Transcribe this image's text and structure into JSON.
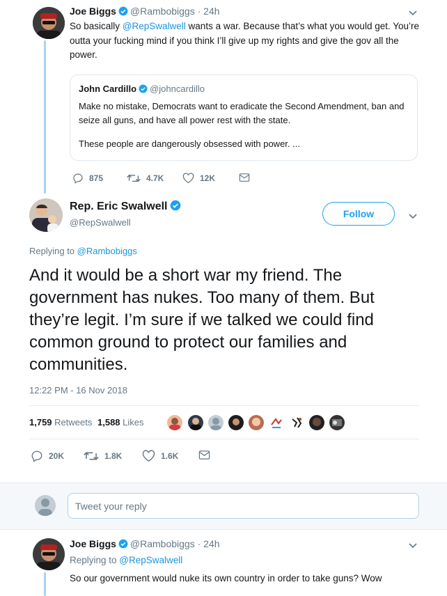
{
  "tweet1": {
    "name": "Joe Biggs",
    "handle": "@Rambobiggs",
    "time": "· 24h",
    "text_pre": "So basically ",
    "mention": "@RepSwalwell",
    "text_post": " wants a war. Because that’s what you would get. You’re outta your fucking mind if you think I’ll give up my rights and give the gov all the power.",
    "quote": {
      "name": "John Cardillo",
      "handle": "@johncardillo",
      "line1": "Make no mistake, Democrats want to eradicate the Second Amendment, ban and seize all guns, and have all power rest with the state.",
      "line2": "These people are dangerously obsessed with power.  ..."
    },
    "actions": {
      "replies": "875",
      "retweets": "4.7K",
      "likes": "12K"
    }
  },
  "main_tweet": {
    "name": "Rep. Eric Swalwell",
    "handle": "@RepSwalwell",
    "follow_label": "Follow",
    "replying_prefix": "Replying to ",
    "replying_to": "@Rambobiggs",
    "text": "And it would be a short war my friend. The government has nukes. Too many of them. But they’re legit. I’m sure if we talked we could find common ground to protect our families and communities.",
    "timestamp": "12:22 PM - 16 Nov 2018",
    "retweets_count": "1,759",
    "retweets_label": "Retweets",
    "likes_count": "1,588",
    "likes_label": "Likes",
    "actions": {
      "replies": "20K",
      "retweets": "1.8K",
      "likes": "1.6K"
    }
  },
  "reply_box": {
    "placeholder": "Tweet your reply"
  },
  "tweet3": {
    "name": "Joe Biggs",
    "handle": "@Rambobiggs",
    "time": "· 24h",
    "replying_prefix": "Replying to ",
    "replying_to": "@RepSwalwell",
    "text": "So our government would nuke its own country in order to take guns? Wow"
  },
  "colors": {
    "accent": "#1da1f2",
    "link": "#1b95e0",
    "muted": "#657786",
    "thread": "#a8d4ef"
  }
}
